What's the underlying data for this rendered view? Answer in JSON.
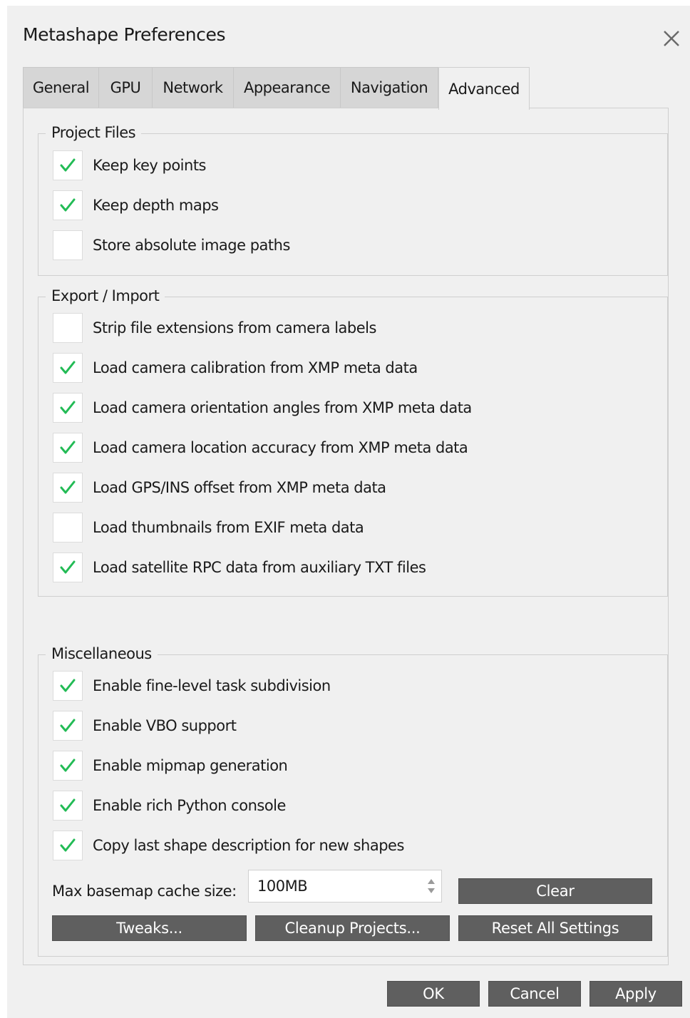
{
  "window": {
    "title": "Metashape Preferences",
    "close_icon": "close-icon"
  },
  "tabs": [
    {
      "label": "General"
    },
    {
      "label": "GPU"
    },
    {
      "label": "Network"
    },
    {
      "label": "Appearance"
    },
    {
      "label": "Navigation"
    },
    {
      "label": "Advanced",
      "active": true
    }
  ],
  "project_files": {
    "title": "Project Files",
    "items": [
      {
        "label": "Keep key points",
        "checked": true
      },
      {
        "label": "Keep depth maps",
        "checked": true
      },
      {
        "label": "Store absolute image paths",
        "checked": false
      }
    ]
  },
  "export_import": {
    "title": "Export / Import",
    "items": [
      {
        "label": "Strip file extensions from camera labels",
        "checked": false
      },
      {
        "label": "Load camera calibration from XMP meta data",
        "checked": true
      },
      {
        "label": "Load camera orientation angles from XMP meta data",
        "checked": true
      },
      {
        "label": "Load camera location accuracy from XMP meta data",
        "checked": true
      },
      {
        "label": "Load GPS/INS offset from XMP meta data",
        "checked": true
      },
      {
        "label": "Load thumbnails from EXIF meta data",
        "checked": false
      },
      {
        "label": "Load satellite RPC data from auxiliary TXT files",
        "checked": true
      }
    ]
  },
  "miscellaneous": {
    "title": "Miscellaneous",
    "items": [
      {
        "label": "Enable fine-level task subdivision",
        "checked": true
      },
      {
        "label": "Enable VBO support",
        "checked": true
      },
      {
        "label": "Enable mipmap generation",
        "checked": true
      },
      {
        "label": "Enable rich Python console",
        "checked": true
      },
      {
        "label": "Copy last shape description for new shapes",
        "checked": true
      }
    ],
    "cache_label": "Max basemap cache size:",
    "cache_value": "100MB",
    "clear_label": "Clear",
    "tweaks_label": "Tweaks...",
    "cleanup_label": "Cleanup Projects...",
    "reset_label": "Reset All Settings"
  },
  "footer": {
    "ok_label": "OK",
    "cancel_label": "Cancel",
    "apply_label": "Apply"
  },
  "colors": {
    "dialog_bg": "#f0f0f0",
    "check": "#22bb55",
    "button_bg": "#5f5f5f",
    "tab_inactive": "#d6d6d6"
  }
}
